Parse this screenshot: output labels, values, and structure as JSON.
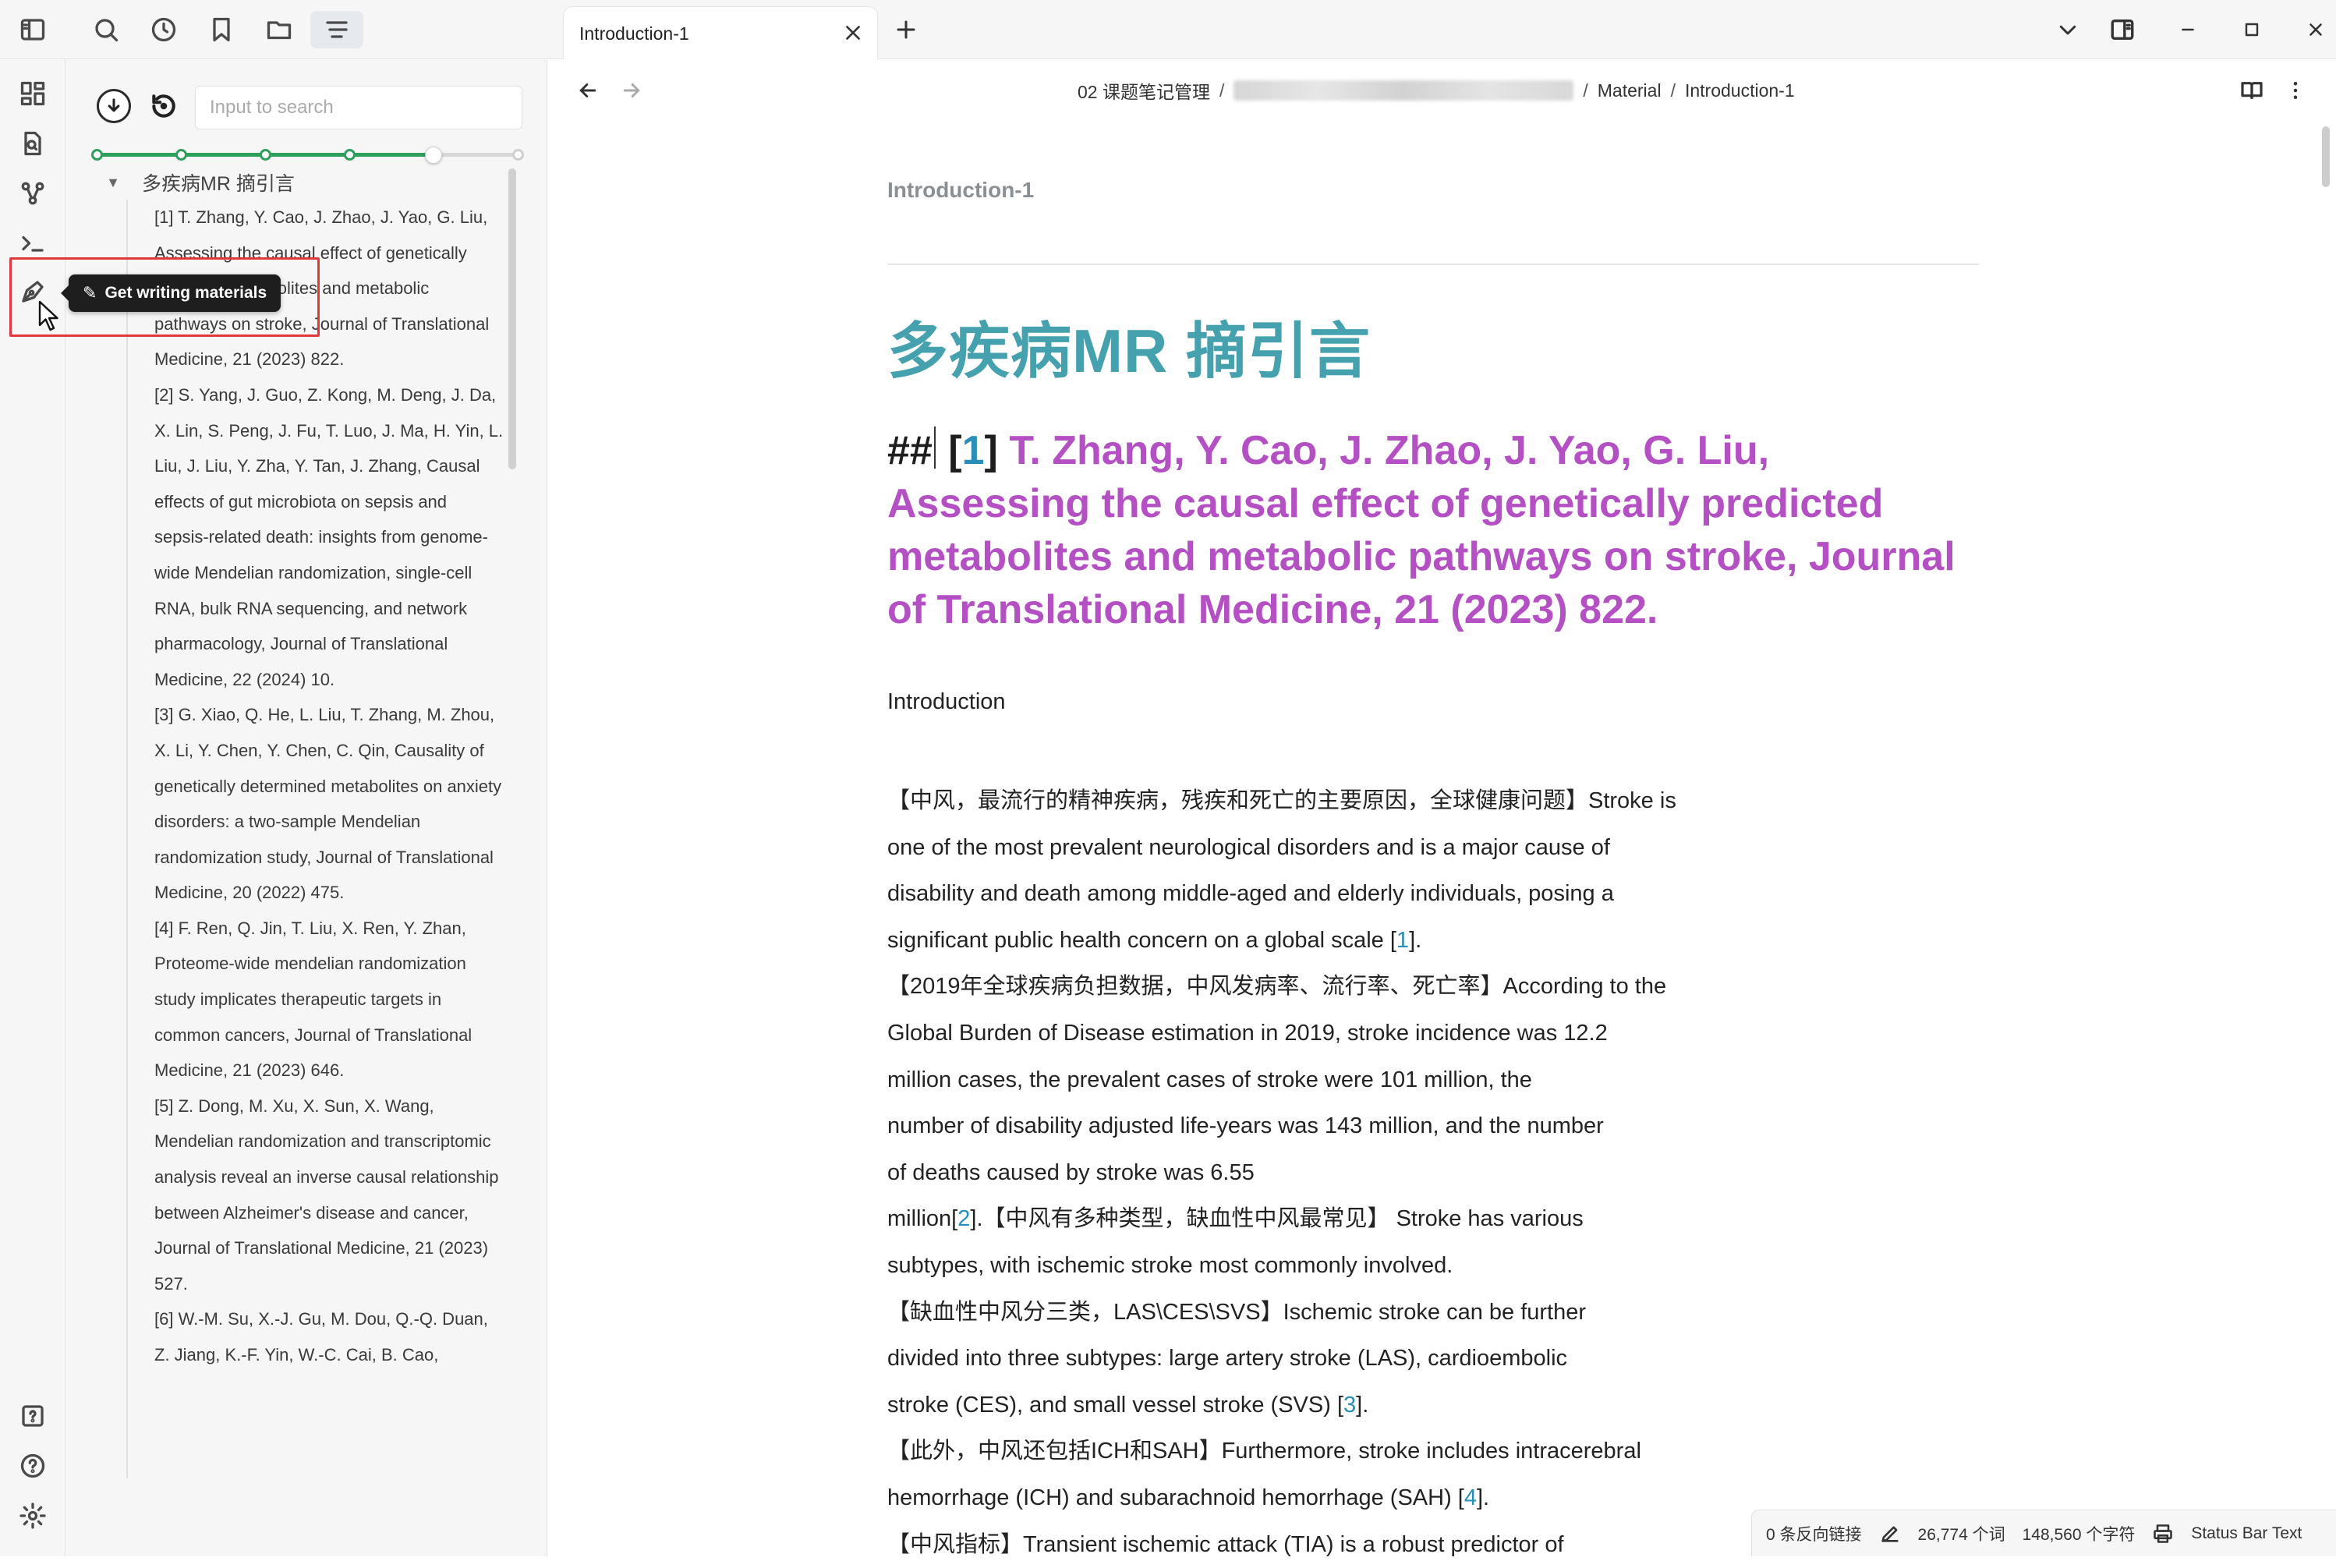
{
  "tab": {
    "title": "Introduction-1"
  },
  "breadcrumb": {
    "root": "02 课题笔记管理",
    "sep": "/",
    "folder2": "Material",
    "file": "Introduction-1"
  },
  "sidepanel": {
    "search_placeholder": "Input to search",
    "heading_level": {
      "levels": 6,
      "selected": 5
    },
    "outline_root": "多疾病MR 摘引言",
    "references": [
      "[1] T. Zhang, Y. Cao, J. Zhao, J. Yao, G. Liu, Assessing the causal effect of genetically predicted metabolites and metabolic pathways on stroke, Journal of Translational Medicine, 21 (2023) 822.",
      "[2] S. Yang, J. Guo, Z. Kong, M. Deng, J. Da, X. Lin, S. Peng, J. Fu, T. Luo, J. Ma, H. Yin, L. Liu, J. Liu, Y. Zha, Y. Tan, J. Zhang, Causal effects of gut microbiota on sepsis and sepsis-related death: insights from genome-wide Mendelian randomization, single-cell RNA, bulk RNA sequencing, and network pharmacology, Journal of Translational Medicine, 22 (2024) 10.",
      "[3] G. Xiao, Q. He, L. Liu, T. Zhang, M. Zhou, X. Li, Y. Chen, Y. Chen, C. Qin, Causality of genetically determined metabolites on anxiety disorders: a two-sample Mendelian randomization study, Journal of Translational Medicine, 20 (2022) 475.",
      "[4] F. Ren, Q. Jin, T. Liu, X. Ren, Y. Zhan, Proteome-wide mendelian randomization study implicates therapeutic targets in common cancers, Journal of Translational Medicine, 21 (2023) 646.",
      "[5] Z. Dong, M. Xu, X. Sun, X. Wang, Mendelian randomization and transcriptomic analysis reveal an inverse causal relationship between Alzheimer's disease and cancer, Journal of Translational Medicine, 21 (2023) 527.",
      "[6] W.-M. Su, X.-J. Gu, M. Dou, Q.-Q. Duan, Z. Jiang, K.-F. Yin, W.-C. Cai, B. Cao,"
    ]
  },
  "tooltip": {
    "label": "Get writing materials"
  },
  "document": {
    "inline_title": "Introduction-1",
    "h1": "多疾病MR 摘引言",
    "h2": {
      "marker": "##",
      "num": "1",
      "text": "T. Zhang, Y. Cao, J. Zhao, J. Yao, G. Liu, Assessing the causal effect of genetically predicted metabolites and metabolic pathways on stroke, Journal of Translational Medicine, 21 (2023) 822."
    },
    "intro_label": "Introduction",
    "para": {
      "l1": "【中风，最流行的精神疾病，残疾和死亡的主要原因，全球健康问题】Stroke is",
      "l2": "one of the most prevalent neurological disorders and is a major cause of",
      "l3": "disability and death among middle-aged and elderly individuals, posing a",
      "l4a": "significant public health concern on a global scale [",
      "cite1": "1",
      "l4b": "].",
      "l5": "【2019年全球疾病负担数据，中风发病率、流行率、死亡率】According to the",
      "l6": "Global Burden of Disease estimation in 2019, stroke incidence was 12.2",
      "l7": "million cases, the prevalent cases of stroke were 101 million, the",
      "l8": "number of disability adjusted life-years was 143 million, and the number",
      "l9": "of deaths caused by stroke was 6.55",
      "l10a": "million[",
      "cite2": "2",
      "l10b": "].【中风有多种类型，缺血性中风最常见】 Stroke has various",
      "l11": "subtypes, with ischemic stroke most commonly involved.",
      "l12": "【缺血性中风分三类，LAS\\CES\\SVS】Ischemic stroke can be further",
      "l13": "divided into three subtypes: large artery stroke (LAS), cardioembolic",
      "l14a": "stroke (CES), and small vessel stroke (SVS) [",
      "cite3": "3",
      "l14b": "].",
      "l15": "【此外，中风还包括ICH和SAH】Furthermore, stroke includes intracerebral",
      "l16a": "hemorrhage (ICH) and subarachnoid hemorrhage (SAH) [",
      "cite4": "4",
      "l16b": "].",
      "l17": "【中风指标】Transient ischemic attack (TIA) is a robust predictor of"
    }
  },
  "statusbar": {
    "backlinks": "0 条反向链接",
    "words": "26,774 个词",
    "chars": "148,560 个字符",
    "text": "Status Bar Text"
  },
  "colors": {
    "h1": "#44a1ad",
    "h2": "#b44fc4",
    "link": "#2a8fb8",
    "accent_green": "#2e9e5b",
    "highlight_red": "#e0393b"
  }
}
